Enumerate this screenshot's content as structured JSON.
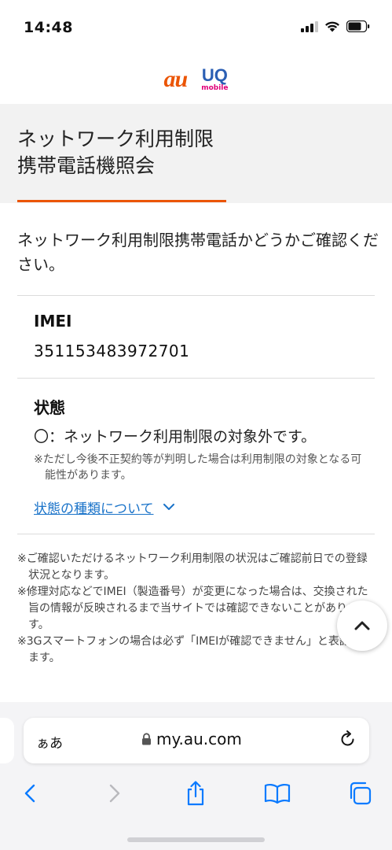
{
  "status": {
    "time": "14:48"
  },
  "logos": {
    "au": "au",
    "uq": "UQ",
    "uq_sub": "mobile"
  },
  "page": {
    "title": "ネットワーク利用制限\n携帯電話機照会",
    "lead": "ネットワーク利用制限携帯電話かどうかご確認ください。"
  },
  "imei": {
    "label": "IMEI",
    "value": "351153483972701"
  },
  "state": {
    "label": "状態",
    "value": "〇：ネットワーク利用制限の対象外です。",
    "note": "※ただし今後不正契約等が判明した場合は利用制限の対象となる可能性があります。",
    "link": "状態の種類について"
  },
  "notes": [
    "※ご確認いただけるネットワーク利用制限の状況はご確認前日での登録状況となります。",
    "※修理対応などでIMEI（製造番号）が変更になった場合は、交換された旨の情報が反映されるまで当サイトでは確認できないことがあります。",
    "※3Gスマートフォンの場合は必ず「IMEIが確認できません」と表記されます。"
  ],
  "browser": {
    "aa": "ぁあ",
    "url": "my.au.com"
  },
  "colors": {
    "accent": "#eb5505",
    "link": "#1a73c9",
    "ios_blue": "#0a7aff"
  }
}
